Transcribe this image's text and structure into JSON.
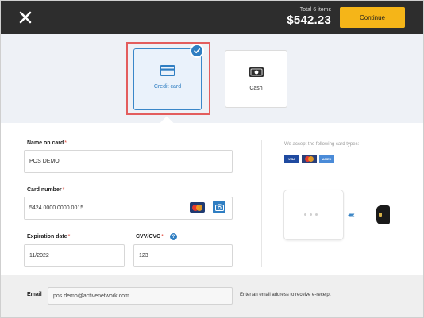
{
  "topbar": {
    "close_icon": "close-icon",
    "total_caption": "Total 6 items",
    "total_amount": "$542.23",
    "continue_label": "Continue",
    "accent_color": "#f5b518",
    "background_color": "#2d2d2d"
  },
  "payment_methods": {
    "items": [
      {
        "label": "Credit card",
        "icon": "credit-card-icon",
        "selected": true
      },
      {
        "label": "Cash",
        "icon": "cash-icon",
        "selected": false
      }
    ],
    "selected_color": "#2f7ec2"
  },
  "form": {
    "name_on_card": {
      "label": "Name on card",
      "required_mark": "*",
      "value": "POS DEMO"
    },
    "card_number": {
      "label": "Card number",
      "required_mark": "*",
      "value": "5424 0000 0000 0015",
      "card_brand_icon": "mastercard-icon",
      "scan_icon": "camera-icon"
    },
    "expiration_date": {
      "label": "Expiration date",
      "required_mark": "*",
      "value": "11/2022"
    },
    "cvv": {
      "label": "CVV/CVC",
      "required_mark": "*",
      "value": "123",
      "help_icon": "?"
    }
  },
  "accepted_cards": {
    "caption": "We accept the following card types:",
    "cards": [
      "VISA",
      "mastercard",
      "AMEX"
    ]
  },
  "email": {
    "label": "Email",
    "value": "pos.demo@activenetwork.com",
    "hint": "Enter an email address to receive e-receipt"
  }
}
